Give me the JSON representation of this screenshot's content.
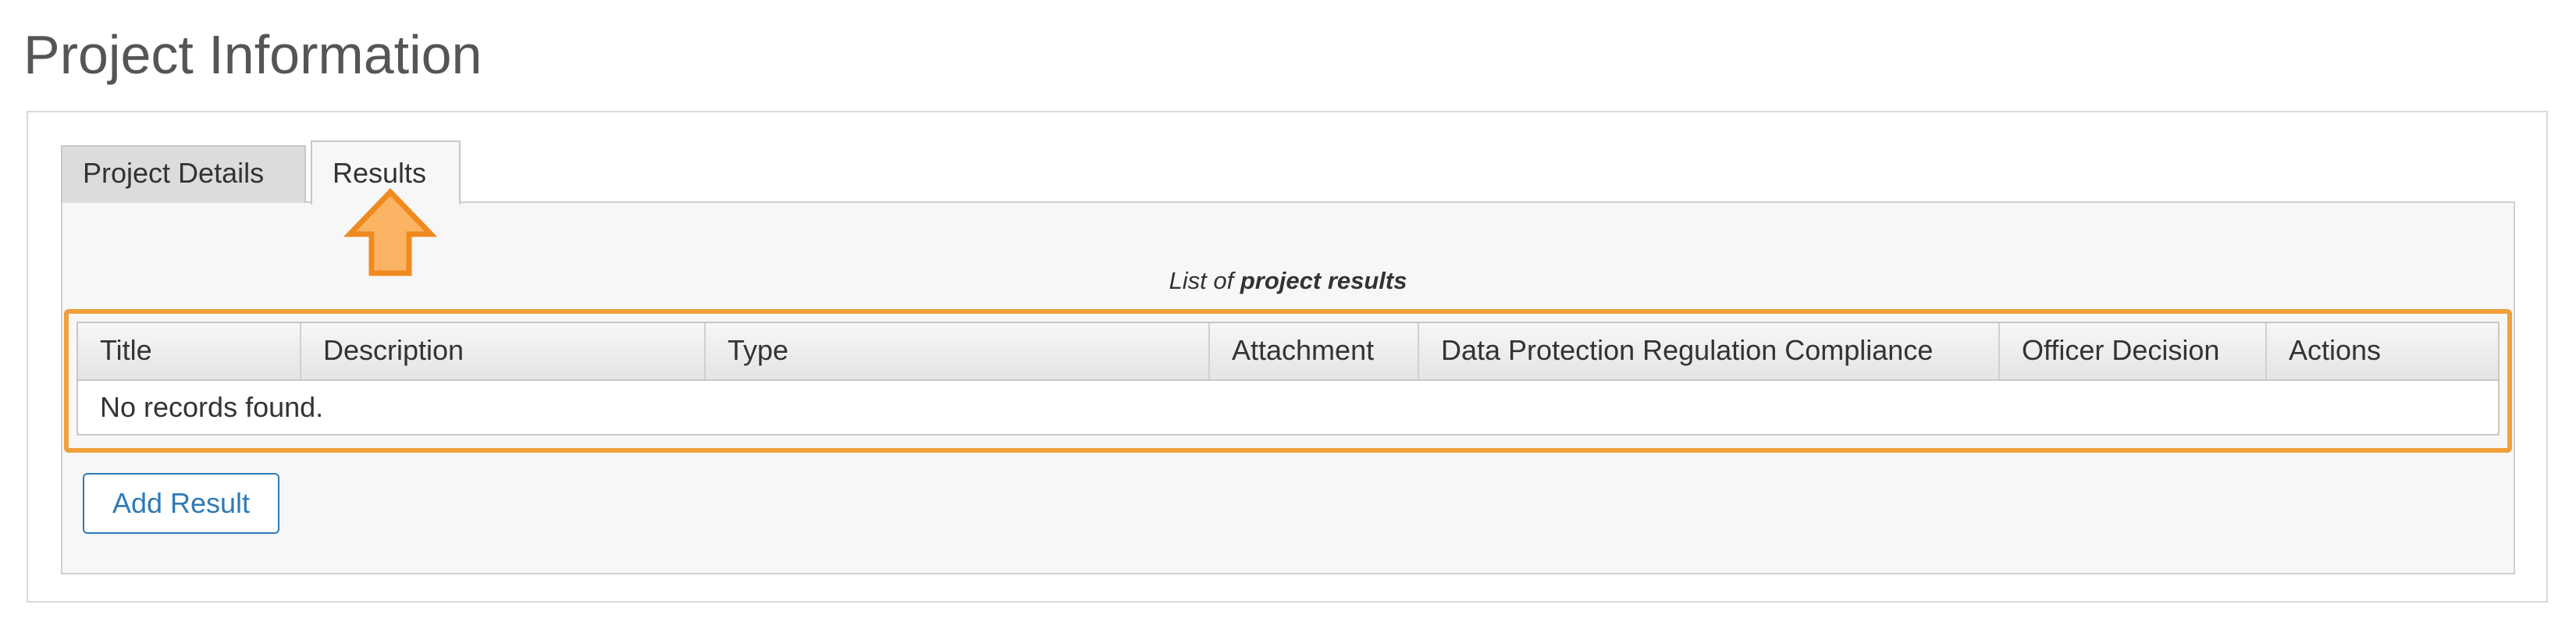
{
  "page": {
    "title": "Project Information"
  },
  "tabs": [
    {
      "label": "Project Details",
      "active": false
    },
    {
      "label": "Results",
      "active": true
    }
  ],
  "results": {
    "caption_prefix": "List of",
    "caption_emphasis": "project results",
    "columns": [
      "Title",
      "Description",
      "Type",
      "Attachment",
      "Data Protection Regulation Compliance",
      "Officer Decision",
      "Actions"
    ],
    "empty_message": "No records found.",
    "add_button_label": "Add Result"
  },
  "annotation": {
    "arrow_icon": "arrow-up-icon",
    "highlight_color": "#f0a03a"
  },
  "colors": {
    "link_blue": "#2e7bb8",
    "panel_bg": "#f7f7f7",
    "inactive_tab_bg": "#dcdcdc"
  }
}
